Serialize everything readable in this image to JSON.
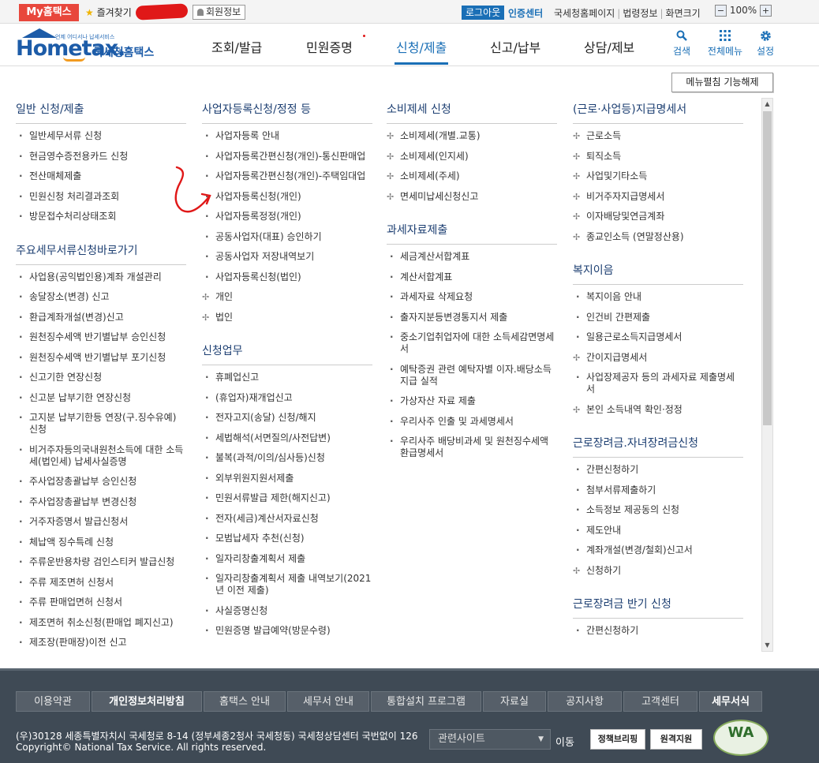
{
  "topbar": {
    "my_hometax": "My홈택스",
    "favorites": "즐겨찾기",
    "user_info": "회원정보",
    "logout": "로그아웃",
    "cert_center": "인증센터",
    "links": [
      "국세청홈페이지",
      "법령정보",
      "화면크기"
    ],
    "zoom_minus": "−",
    "zoom_level": "100%",
    "zoom_plus": "+"
  },
  "header": {
    "logo_sub": "언제 어디서나 납세서비스",
    "logo_main": "Hometax.",
    "logo_kor": "국세청홈택스",
    "nav": [
      "조회/발급",
      "민원증명",
      "신청/제출",
      "신고/납부",
      "상담/제보"
    ],
    "active_nav_index": 2,
    "icons": [
      {
        "label": "검색",
        "icon": "search-icon"
      },
      {
        "label": "전체메뉴",
        "icon": "grid-icon"
      },
      {
        "label": "설정",
        "icon": "gear-icon"
      }
    ]
  },
  "menu": {
    "unfold_button": "메뉴펼침 기능해제",
    "columns": [
      {
        "sections": [
          {
            "title": "일반 신청/제출",
            "items": [
              "일반세무서류 신청",
              "현금영수증전용카드 신청",
              "전산매체제출",
              "민원신청 처리결과조회",
              "방문접수처리상태조회"
            ]
          },
          {
            "title": "주요세무서류신청바로가기",
            "items": [
              "사업용(공익법인용)계좌 개설관리",
              "송달장소(변경) 신고",
              "환급계좌개설(변경)신고",
              "원천징수세액 반기별납부 승인신청",
              "원천징수세액 반기별납부 포기신청",
              "신고기한 연장신청",
              "신고분 납부기한 연장신청",
              "고지분 납부기한등 연장(구.징수유예) 신청",
              "비거주자등의국내원천소득에 대한 소득세(법인세) 납세사실증명",
              "주사업장총괄납부 승인신청",
              "주사업장총괄납부 변경신청",
              "거주자증명서 발급신청서",
              "체납액 징수특례 신청",
              "주류운반용차량 검인스티커 발급신청",
              "주류 제조면허 신청서",
              "주류 판매업면허 신청서",
              "제조면허 취소신청(판매업 폐지신고)",
              "제조장(판매장)이전 신고"
            ]
          }
        ]
      },
      {
        "sections": [
          {
            "title": "사업자등록신청/정정 등",
            "items": [
              "사업자등록 안내",
              "사업자등록간편신청(개인)-통신판매업",
              "사업자등록간편신청(개인)-주택임대업",
              "사업자등록신청(개인)",
              "사업자등록정정(개인)",
              "공동사업자(대표) 승인하기",
              "공동사업자 저장내역보기",
              "사업자등록신청(법인)",
              "+개인",
              "+법인"
            ]
          },
          {
            "title": "신청업무",
            "items": [
              "휴폐업신고",
              "(휴업자)재개업신고",
              "전자고지(송달) 신청/해지",
              "세법해석(서면질의/사전답변)",
              "불복(과적/이의/심사등)신청",
              "외부위원지원서제출",
              "민원서류발급 제한(해지신고)",
              "전자(세금)계산서자료신청",
              "모범납세자 추천(신청)",
              "일자리창출계획서 제출",
              "일자리창출계획서 제출 내역보기(2021년 이전 제출)",
              "사실증명신청",
              "민원증명 발급예약(방문수령)"
            ]
          }
        ]
      },
      {
        "sections": [
          {
            "title": "소비제세 신청",
            "items": [
              "+소비제세(개별.교통)",
              "+소비제세(인지세)",
              "+소비제세(주세)",
              "+면세미납세신청신고"
            ]
          },
          {
            "title": "과세자료제출",
            "items": [
              "세금계산서합계표",
              "계산서합계표",
              "과세자료 삭제요청",
              "출자지분등변경통지서 제출",
              "중소기업취업자에 대한 소득세감면명세서",
              "예탁증권 관련 예탁자별 이자.배당소득 지급 실적",
              "가상자산 자료 제출",
              "우리사주 인출 및 과세명세서",
              "우리사주 배당비과세 및 원천징수세액 환급명세서"
            ]
          }
        ]
      },
      {
        "sections": [
          {
            "title": "(근로·사업등)지급명세서",
            "items": [
              "+근로소득",
              "+퇴직소득",
              "+사업및기타소득",
              "+비거주자지급명세서",
              "+이자배당및연금계좌",
              "+종교인소득 (연말정산용)"
            ]
          },
          {
            "title": "복지이음",
            "items": [
              "복지이음 안내",
              "인건비 간편제출",
              "일용근로소득지급명세서",
              "+간이지급명세서",
              "사업장제공자 등의 과세자료 제출명세서",
              "+본인 소득내역 확인·정정"
            ]
          },
          {
            "title": "근로장려금.자녀장려금신청",
            "items": [
              "간편신청하기",
              "첨부서류제출하기",
              "소득정보 제공동의 신청",
              "제도안내",
              "계좌개설(변경/철회)신고서",
              "+신청하기"
            ]
          },
          {
            "title": "근로장려금 반기 신청",
            "items": [
              "간편신청하기"
            ]
          }
        ]
      }
    ]
  },
  "footer": {
    "nav": [
      {
        "label": "이용약관",
        "bold": false,
        "w": 94
      },
      {
        "label": "개인정보처리방침",
        "bold": true,
        "w": 140
      },
      {
        "label": "홈택스 안내",
        "bold": false,
        "w": 104
      },
      {
        "label": "세무서 안내",
        "bold": false,
        "w": 104
      },
      {
        "label": "통합설치 프로그램",
        "bold": false,
        "w": 140
      },
      {
        "label": "자료실",
        "bold": false,
        "w": 80
      },
      {
        "label": "공지사항",
        "bold": false,
        "w": 94
      },
      {
        "label": "고객센터",
        "bold": false,
        "w": 94
      },
      {
        "label": "세무서식",
        "bold": true,
        "w": 80
      }
    ],
    "address": "(우)30128 세종특별자치시 국세청로 8-14 (정부세종2청사 국세청동) 국세청상담센터 국번없이 126",
    "copyright": "Copyright© National Tax Service. All rights reserved.",
    "related_sites": "관련사이트",
    "go": "이동",
    "badge1": "정책브리핑",
    "badge2": "원격지원",
    "wa_mark": "WA"
  }
}
